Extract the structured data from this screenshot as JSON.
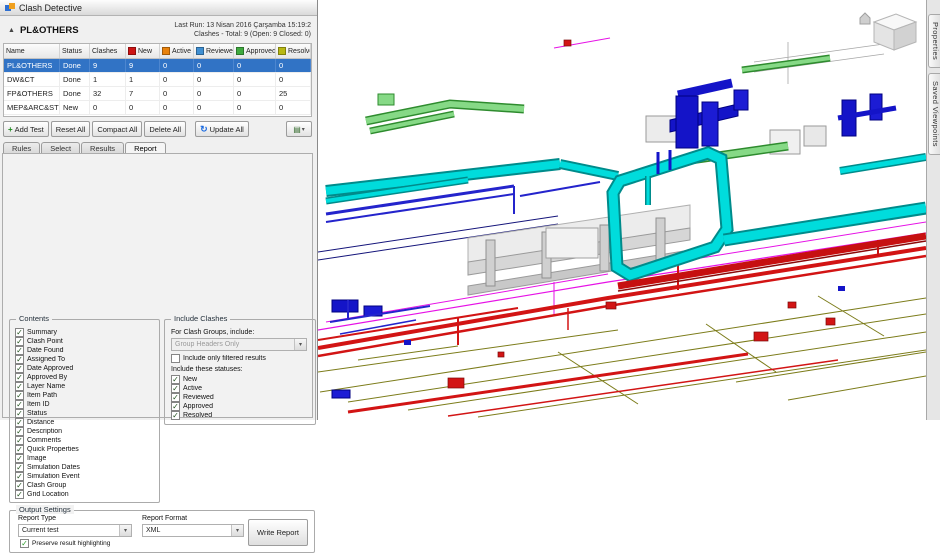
{
  "panel": {
    "title": "Clash Detective",
    "test": {
      "name": "PL&OTHERS",
      "last_run": "Last Run:  13 Nisan 2016 Çarşamba 15:19:2",
      "summary": "Clashes - Total: 9 (Open: 9  Closed: 0)"
    },
    "table": {
      "columns": [
        {
          "label": "Name"
        },
        {
          "label": "Status"
        },
        {
          "label": "Clashes"
        },
        {
          "label": "New",
          "color": "#cc1414"
        },
        {
          "label": "Active",
          "color": "#e8820d"
        },
        {
          "label": "Reviewed",
          "color": "#3f8fd2"
        },
        {
          "label": "Approved",
          "color": "#3faa3f"
        },
        {
          "label": "Resolved",
          "color": "#b8b814"
        }
      ],
      "rows": [
        {
          "cells": [
            "PL&OTHERS",
            "Done",
            "9",
            "9",
            "0",
            "0",
            "0",
            "0"
          ],
          "selected": true
        },
        {
          "cells": [
            "DW&CT",
            "Done",
            "1",
            "1",
            "0",
            "0",
            "0",
            "0"
          ],
          "selected": false
        },
        {
          "cells": [
            "FP&OTHERS",
            "Done",
            "32",
            "7",
            "0",
            "0",
            "0",
            "25"
          ],
          "selected": false
        },
        {
          "cells": [
            "MEP&ARC&ST",
            "New",
            "0",
            "0",
            "0",
            "0",
            "0",
            "0"
          ],
          "selected": false
        }
      ]
    },
    "toolbar": {
      "add_test": "Add Test",
      "reset_all": "Reset All",
      "compact_all": "Compact All",
      "delete_all": "Delete All",
      "update_all": "Update All"
    },
    "tabs": [
      {
        "label": "Rules",
        "active": false
      },
      {
        "label": "Select",
        "active": false
      },
      {
        "label": "Results",
        "active": false
      },
      {
        "label": "Report",
        "active": true
      }
    ],
    "contents": {
      "title": "Contents",
      "items": [
        {
          "label": "Summary",
          "checked": true
        },
        {
          "label": "Clash Point",
          "checked": true
        },
        {
          "label": "Date Found",
          "checked": true
        },
        {
          "label": "Assigned To",
          "checked": true
        },
        {
          "label": "Date Approved",
          "checked": true
        },
        {
          "label": "Approved By",
          "checked": true
        },
        {
          "label": "Layer Name",
          "checked": true
        },
        {
          "label": "Item Path",
          "checked": true
        },
        {
          "label": "Item ID",
          "checked": true
        },
        {
          "label": "Status",
          "checked": true
        },
        {
          "label": "Distance",
          "checked": true
        },
        {
          "label": "Description",
          "checked": true
        },
        {
          "label": "Comments",
          "checked": true
        },
        {
          "label": "Quick Properties",
          "checked": true
        },
        {
          "label": "Image",
          "checked": true
        },
        {
          "label": "Simulation Dates",
          "checked": true
        },
        {
          "label": "Simulation Event",
          "checked": true
        },
        {
          "label": "Clash Group",
          "checked": true
        },
        {
          "label": "Grid Location",
          "checked": true
        }
      ]
    },
    "include_clashes": {
      "title": "Include Clashes",
      "group_label": "For Clash Groups, include:",
      "group_value": "Group Headers Only",
      "filtered": {
        "label": "Include only filtered results",
        "checked": false
      },
      "statuses_label": "Include these statuses:",
      "statuses": [
        {
          "label": "New",
          "checked": true
        },
        {
          "label": "Active",
          "checked": true
        },
        {
          "label": "Reviewed",
          "checked": true
        },
        {
          "label": "Approved",
          "checked": true
        },
        {
          "label": "Resolved",
          "checked": true
        }
      ]
    },
    "output": {
      "title": "Output Settings",
      "report_type_label": "Report Type",
      "report_type_value": "Current test",
      "report_format_label": "Report Format",
      "report_format_value": "XML",
      "preserve": {
        "label": "Preserve result highlighting",
        "checked": true
      },
      "write_report": "Write Report"
    }
  },
  "viewport": {
    "side_tabs": [
      "Properties",
      "Saved Viewpoints"
    ],
    "model_colors": {
      "cyan_duct": "#00dcdc",
      "blue_duct": "#1414c8",
      "red_pipe": "#d21414",
      "green_duct": "#86d986",
      "olive_line": "#7c7c1a",
      "magenta_line": "#e612e6",
      "structure_gray": "#d6d6d6"
    }
  },
  "icons": {
    "collapse": "▲",
    "add": "+",
    "update": "↻",
    "dropdown_arrow": "▾",
    "report_menu": "▤",
    "check": "✓"
  }
}
